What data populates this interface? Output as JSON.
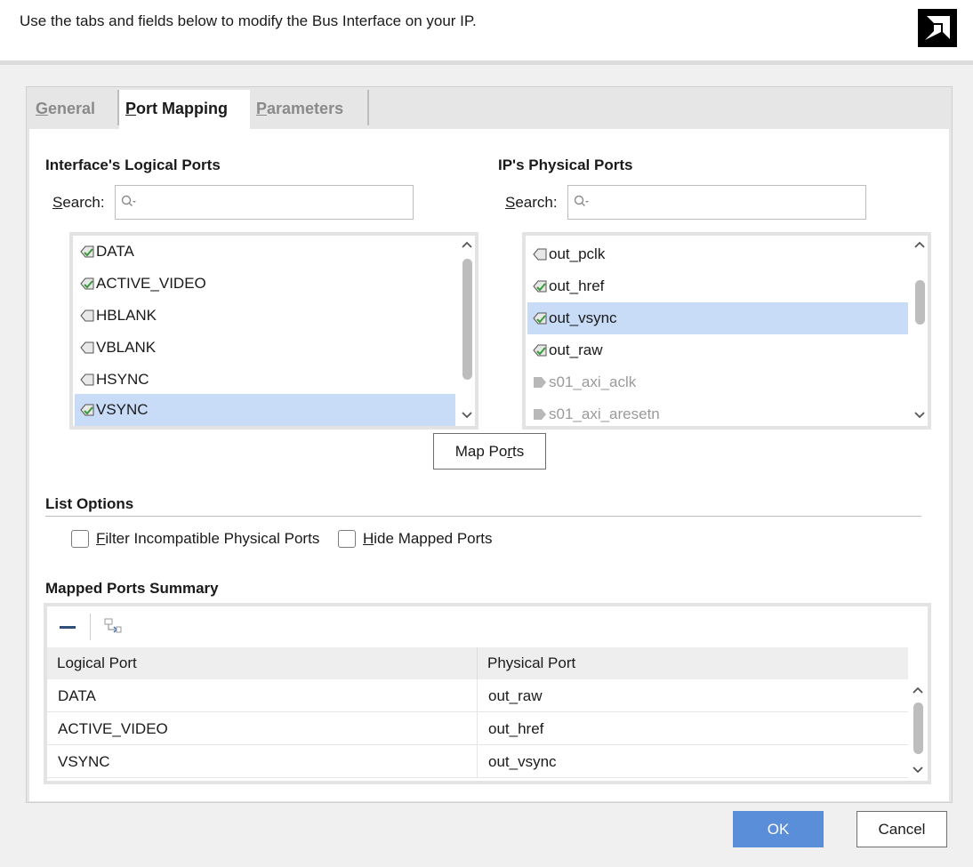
{
  "header": {
    "instruction": "Use the tabs and fields below to modify the Bus Interface on your IP."
  },
  "tabs": [
    {
      "label_first": "G",
      "label_rest": "eneral",
      "active": false
    },
    {
      "label_first": "P",
      "label_rest": "ort Mapping",
      "active": true
    },
    {
      "label_first": "P",
      "label_rest": "arameters",
      "active": false
    }
  ],
  "logical": {
    "title": "Interface's Logical Ports",
    "search_label_first": "S",
    "search_label_rest": "earch:",
    "search_placeholder": "",
    "items": [
      {
        "label": "DATA",
        "icon": "port-connected-icon"
      },
      {
        "label": "ACTIVE_VIDEO",
        "icon": "port-connected-icon"
      },
      {
        "label": "HBLANK",
        "icon": "port-icon"
      },
      {
        "label": "VBLANK",
        "icon": "port-icon"
      },
      {
        "label": "HSYNC",
        "icon": "port-icon"
      },
      {
        "label": "VSYNC",
        "icon": "port-connected-icon",
        "selected": true
      }
    ]
  },
  "physical": {
    "title": "IP's Physical Ports",
    "search_label_first": "S",
    "search_label_rest": "earch:",
    "search_placeholder": "",
    "items": [
      {
        "label": "out_pclk",
        "icon": "port-icon"
      },
      {
        "label": "out_href",
        "icon": "port-connected-icon"
      },
      {
        "label": "out_vsync",
        "icon": "port-connected-icon",
        "selected": true
      },
      {
        "label": "out_raw",
        "icon": "port-connected-icon"
      },
      {
        "label": "s01_axi_aclk",
        "icon": "port-input-icon",
        "dimmed": true
      },
      {
        "label": "s01_axi_aresetn",
        "icon": "port-input-icon",
        "dimmed": true
      }
    ]
  },
  "map_ports": {
    "label_a": "Map Po",
    "label_mn": "r",
    "label_b": "ts"
  },
  "list_options": {
    "title": "List Options",
    "filter": {
      "mn": "F",
      "rest": "ilter Incompatible Physical Ports",
      "checked": false
    },
    "hide": {
      "mn": "H",
      "rest": "ide Mapped Ports",
      "checked": false
    }
  },
  "summary": {
    "title": "Mapped Ports Summary",
    "columns": [
      "Logical Port",
      "Physical Port"
    ],
    "rows": [
      [
        "DATA",
        "out_raw"
      ],
      [
        "ACTIVE_VIDEO",
        "out_href"
      ],
      [
        "VSYNC",
        "out_vsync"
      ]
    ]
  },
  "buttons": {
    "ok": "OK",
    "cancel": "Cancel"
  },
  "colors": {
    "accent": "#5b8ed8",
    "selection": "#c8dcf8",
    "port_green": "#3a9a3a"
  }
}
